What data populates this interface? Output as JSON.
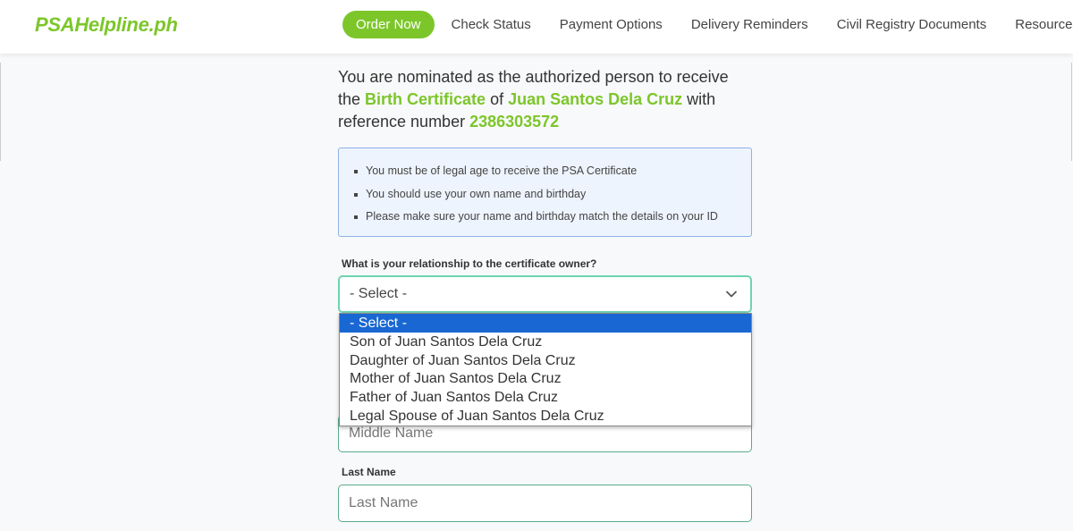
{
  "header": {
    "logo": "PSAHelpline.ph",
    "nav": [
      {
        "label": "Order Now",
        "active": true
      },
      {
        "label": "Check Status"
      },
      {
        "label": "Payment Options"
      },
      {
        "label": "Delivery Reminders"
      },
      {
        "label": "Civil Registry Documents"
      },
      {
        "label": "Resources"
      }
    ]
  },
  "intro": {
    "text_1": "You are nominated as the authorized person to receive the ",
    "document": "Birth Certificate",
    "text_2": " of ",
    "owner": "Juan Santos Dela Cruz",
    "text_3": " with reference number ",
    "reference": "2386303572"
  },
  "notice": {
    "items": [
      "You must be of legal age to receive the PSA Certificate",
      "You should use your own name and birthday",
      "Please make sure your name and birthday match the details on your ID"
    ]
  },
  "relationship": {
    "label": "What is your relationship to the certificate owner?",
    "value": "- Select -",
    "options": [
      "- Select -",
      "Son of Juan Santos Dela Cruz",
      "Daughter of Juan Santos Dela Cruz",
      "Mother of Juan Santos Dela Cruz",
      "Father of Juan Santos Dela Cruz",
      "Legal Spouse of Juan Santos Dela Cruz"
    ]
  },
  "middle_name": {
    "placeholder": "Middle Name"
  },
  "last_name": {
    "label": "Last Name",
    "placeholder": "Last Name"
  },
  "colors": {
    "brand": "#7cc62a",
    "option_highlight": "#1967d2",
    "field_border": "#6fd3b0"
  }
}
